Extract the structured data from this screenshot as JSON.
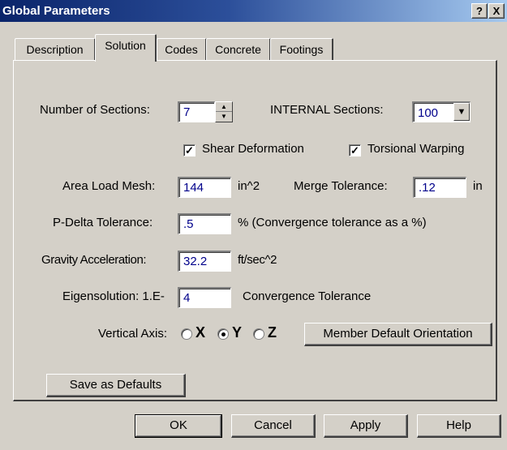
{
  "window": {
    "title": "Global Parameters",
    "help_label": "?",
    "close_label": "X"
  },
  "tabs": [
    {
      "label": "Description"
    },
    {
      "label": "Solution"
    },
    {
      "label": "Codes"
    },
    {
      "label": "Concrete"
    },
    {
      "label": "Footings"
    }
  ],
  "active_tab": "Solution",
  "solution": {
    "sections_label": "Number of Sections:",
    "sections_value": "7",
    "internal_label": "INTERNAL Sections:",
    "internal_value": "100",
    "shear_label": "Shear Deformation",
    "shear_checked": true,
    "torsional_label": "Torsional Warping",
    "torsional_checked": true,
    "area_mesh_label": "Area Load Mesh:",
    "area_mesh_value": "144",
    "area_mesh_unit": "in^2",
    "merge_label": "Merge Tolerance:",
    "merge_value": ".12",
    "merge_unit": "in",
    "pdelta_label": "P-Delta Tolerance:",
    "pdelta_value": ".5",
    "pdelta_note": "% (Convergence tolerance as a %)",
    "gravity_label": "Gravity Acceleration:",
    "gravity_value": "32.2",
    "gravity_unit": "ft/sec^2",
    "eigen_label": "Eigensolution: 1.E-",
    "eigen_value": "4",
    "eigen_note": "Convergence Tolerance",
    "vertical_label": "Vertical Axis:",
    "axis_x": "X",
    "axis_y": "Y",
    "axis_z": "Z",
    "axis_selected": "Y",
    "member_orient_label": "Member Default Orientation",
    "save_defaults_label": "Save as Defaults"
  },
  "footer": {
    "ok_label": "OK",
    "cancel_label": "Cancel",
    "apply_label": "Apply",
    "help_label": "Help"
  }
}
